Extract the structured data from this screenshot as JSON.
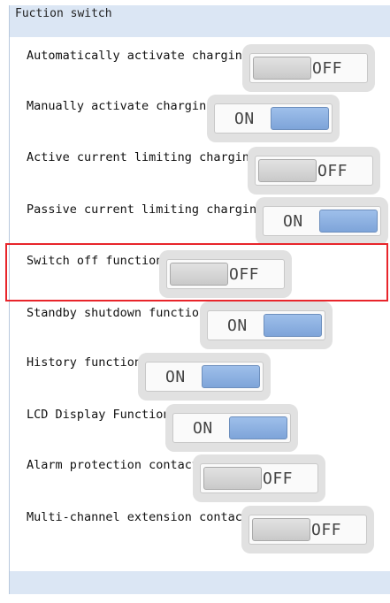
{
  "panel": {
    "title": "Fuction switch"
  },
  "rows": [
    {
      "label": "Automatically activate charging",
      "state": "OFF"
    },
    {
      "label": "Manually activate charging",
      "state": "ON"
    },
    {
      "label": "Active current limiting charging",
      "state": "OFF"
    },
    {
      "label": "Passive current limiting charging",
      "state": "ON"
    },
    {
      "label": "Switch off function",
      "state": "OFF"
    },
    {
      "label": "Standby shutdown function",
      "state": "ON"
    },
    {
      "label": "History function",
      "state": "ON"
    },
    {
      "label": "LCD Display Function",
      "state": "ON"
    },
    {
      "label": "Alarm protection contact",
      "state": "OFF"
    },
    {
      "label": "Multi-channel extension contact",
      "state": "OFF"
    }
  ],
  "colors": {
    "panel_background": "#dbe6f4",
    "switch_on": "#8fb1e2",
    "switch_off": "#d6d6d6",
    "highlight": "#e8252b"
  }
}
